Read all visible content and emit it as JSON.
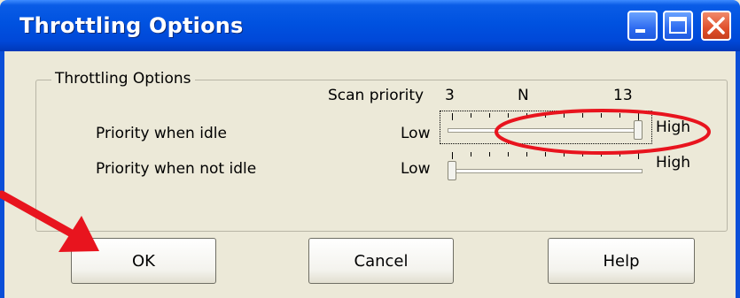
{
  "window": {
    "title": "Throttling Options"
  },
  "group": {
    "legend": "Throttling Options"
  },
  "scale": {
    "label": "Scan priority",
    "min_label": "3",
    "mid_label": "N",
    "max_label": "13"
  },
  "rows": [
    {
      "label": "Priority when idle",
      "low": "Low",
      "high": "High",
      "value": 13
    },
    {
      "label": "Priority when not idle",
      "low": "Low",
      "high": "High",
      "value": 3
    }
  ],
  "buttons": {
    "ok": "OK",
    "cancel": "Cancel",
    "help": "Help"
  },
  "annotation": {
    "arrow_color": "#E8141E",
    "ellipse_color": "#E8141E"
  },
  "colors": {
    "titlebar": "#0052E0",
    "dialog_bg": "#ECE9D8"
  }
}
